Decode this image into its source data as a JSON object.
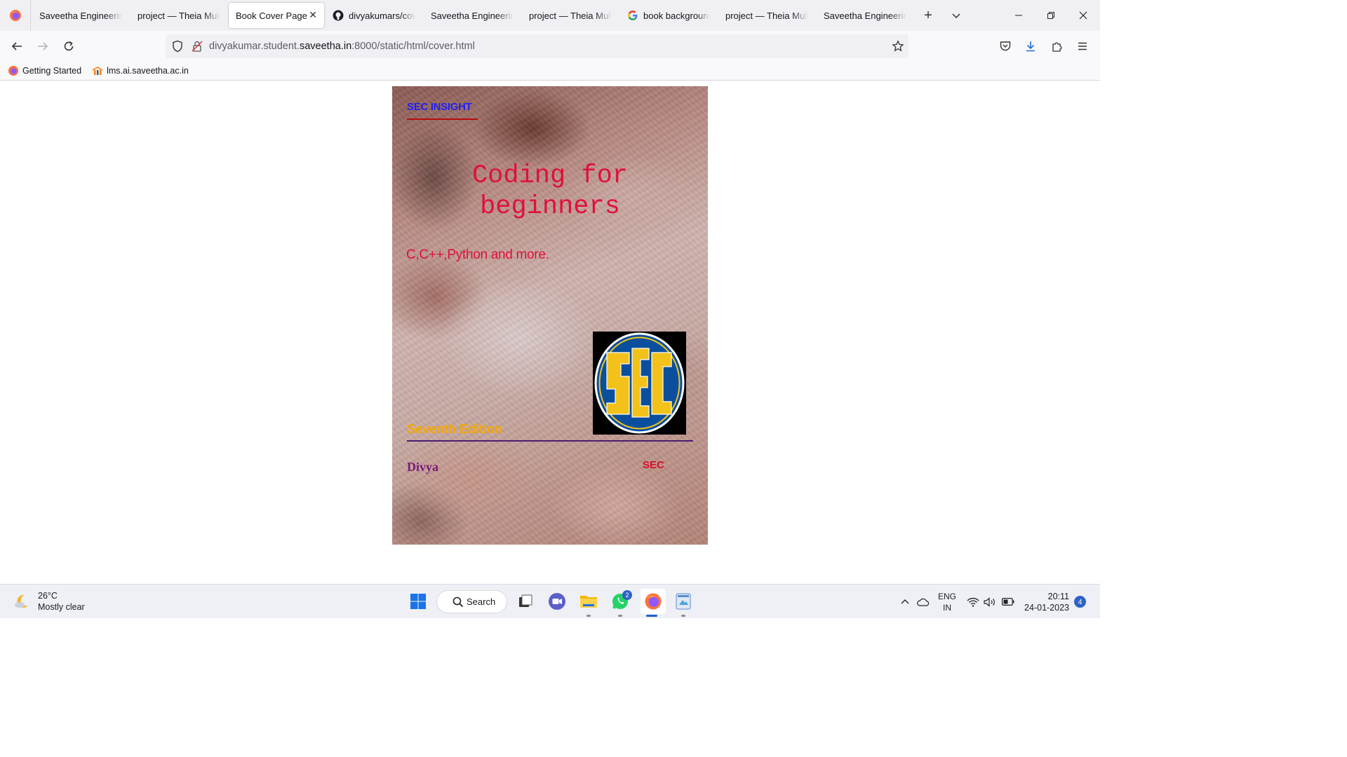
{
  "browser": {
    "tabs": [
      {
        "label": "Saveetha Engineering",
        "icon": "saveetha-favicon"
      },
      {
        "label": "project — Theia Multi",
        "icon": "theia-favicon"
      },
      {
        "label": "Book Cover Page",
        "icon": "none",
        "active": true
      },
      {
        "label": "divyakumars/cove",
        "icon": "github-icon"
      },
      {
        "label": "Saveetha Engineering",
        "icon": "saveetha-favicon"
      },
      {
        "label": "project — Theia Multi",
        "icon": "theia-favicon"
      },
      {
        "label": "book background",
        "icon": "google-icon"
      },
      {
        "label": "project — Theia Multi",
        "icon": "theia-favicon"
      },
      {
        "label": "Saveetha Engineering",
        "icon": "saveetha-favicon"
      }
    ],
    "url": {
      "prefix": "divyakumar.student.",
      "domain": "saveetha.in",
      "suffix": ":8000/static/html/cover.html"
    },
    "bookmarks": [
      {
        "label": "Getting Started",
        "icon": "firefox-icon"
      },
      {
        "label": "lms.ai.saveetha.ac.in",
        "icon": "moodle-icon"
      }
    ]
  },
  "cover": {
    "publisher": "SEC INSIGHT",
    "title": "Coding for beginners",
    "subtitle": "C,C++,Python and more.",
    "logo_text": "SEC",
    "edition": "Seventh Edition",
    "author": "Divya",
    "imprint": "SEC",
    "colors": {
      "publisher": "#1f1ff5",
      "title": "#e0103a",
      "edition": "#f5a800",
      "author": "#7b1a7e",
      "logo_blue": "#0a4f9e",
      "logo_gold": "#f2c21a"
    }
  },
  "taskbar": {
    "weather": {
      "temp": "26°C",
      "condition": "Mostly clear"
    },
    "search_label": "Search",
    "whatsapp_badge": "2",
    "language": {
      "line1": "ENG",
      "line2": "IN"
    },
    "clock": {
      "time": "20:11",
      "date": "24-01-2023"
    },
    "notifications": "4"
  }
}
